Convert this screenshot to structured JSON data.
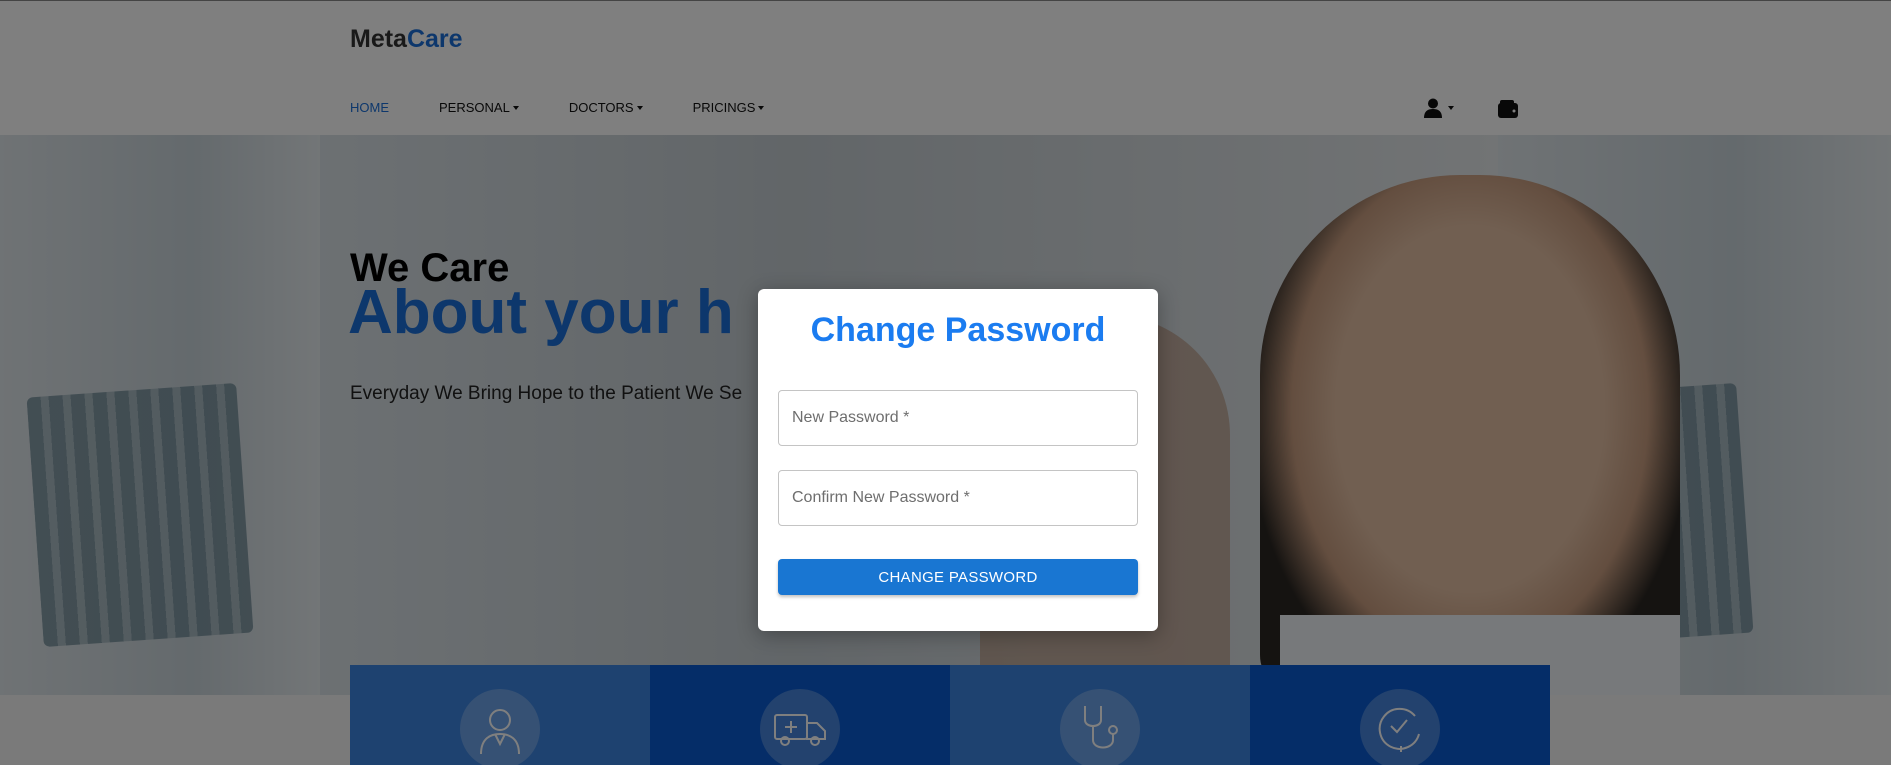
{
  "brand": {
    "part1": "Meta",
    "part2": "Care"
  },
  "nav": {
    "items": [
      {
        "label": "HOME",
        "active": true,
        "dropdown": false
      },
      {
        "label": "PERSONAL",
        "active": false,
        "dropdown": true
      },
      {
        "label": "DOCTORS",
        "active": false,
        "dropdown": true
      },
      {
        "label": "PRICINGS",
        "active": false,
        "dropdown": true
      }
    ],
    "user_icon": "user-icon",
    "wallet_icon": "wallet-icon"
  },
  "hero": {
    "title_line1": "We Care",
    "title_line2": "About your h",
    "subtitle": "Everyday We Bring Hope to the Patient We Se"
  },
  "features": {
    "icons": [
      "doctor-icon",
      "ambulance-icon",
      "stethoscope-icon",
      "clock-24-icon"
    ]
  },
  "modal": {
    "title": "Change Password",
    "new_password_placeholder": "New Password *",
    "confirm_password_placeholder": "Confirm New Password *",
    "submit_label": "CHANGE PASSWORD"
  },
  "colors": {
    "accent": "#1b6fd8",
    "modal_title": "#1b7cf0",
    "button": "#1976d2"
  }
}
